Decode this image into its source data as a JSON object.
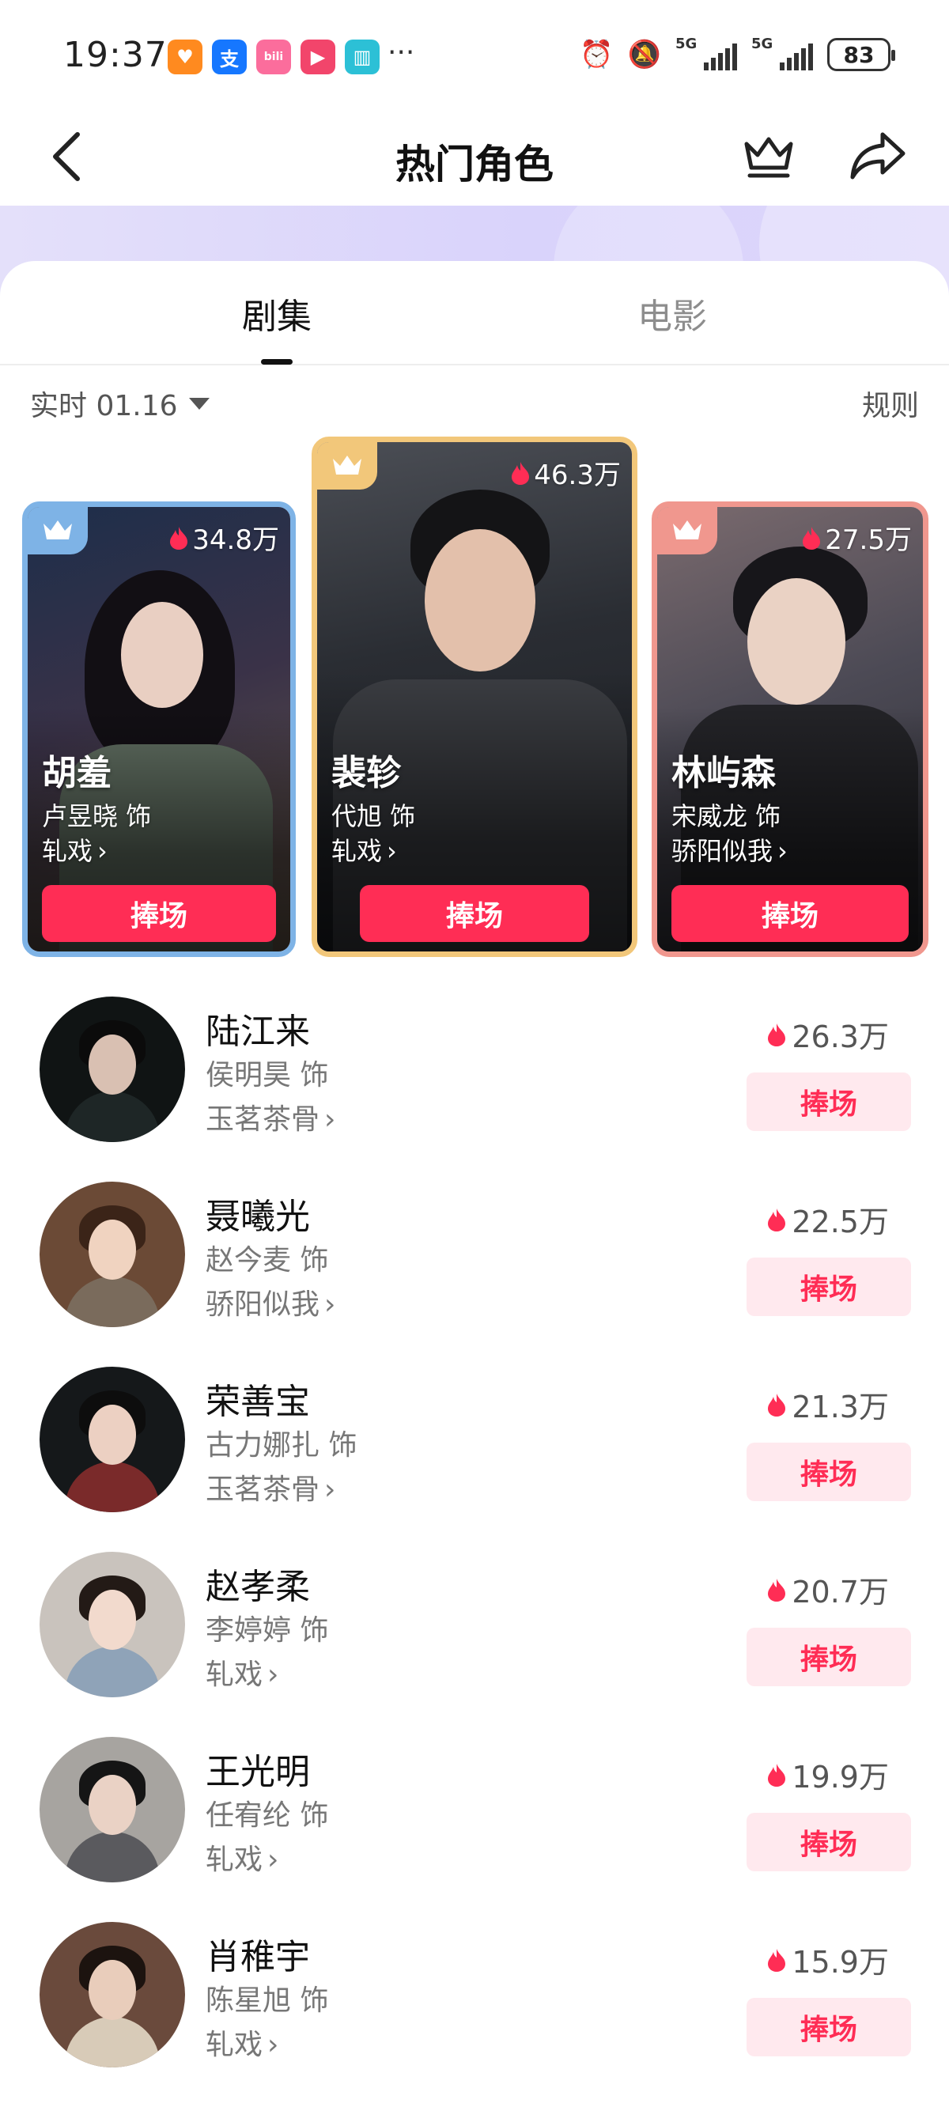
{
  "status_bar": {
    "time": "19:37",
    "more": "···",
    "network_1": "5G",
    "network_2": "5G",
    "battery": "83"
  },
  "header": {
    "title": "热门角色"
  },
  "tabs": [
    {
      "label": "剧集",
      "active": true
    },
    {
      "label": "电影",
      "active": false
    }
  ],
  "filter": {
    "label": "实时 01.16",
    "rules": "规则"
  },
  "colors": {
    "accent": "#ff2d55",
    "accent_light": "#ffe9ee",
    "rank1_border": "#f2c77a",
    "rank2_border": "#7eb3e6",
    "rank3_border": "#f0978e"
  },
  "top3": [
    {
      "rank": 2,
      "name": "胡羞",
      "actor": "卢昱晓 饰",
      "show": "轧戏",
      "heat": "34.8万",
      "button": "捧场"
    },
    {
      "rank": 1,
      "name": "裴轸",
      "actor": "代旭 饰",
      "show": "轧戏",
      "heat": "46.3万",
      "button": "捧场"
    },
    {
      "rank": 3,
      "name": "林屿森",
      "actor": "宋威龙 饰",
      "show": "骄阳似我",
      "heat": "27.5万",
      "button": "捧场"
    }
  ],
  "list": [
    {
      "name": "陆江来",
      "actor": "侯明昊 饰",
      "show": "玉茗茶骨",
      "heat": "26.3万",
      "button": "捧场"
    },
    {
      "name": "聂曦光",
      "actor": "赵今麦 饰",
      "show": "骄阳似我",
      "heat": "22.5万",
      "button": "捧场"
    },
    {
      "name": "荣善宝",
      "actor": "古力娜扎 饰",
      "show": "玉茗茶骨",
      "heat": "21.3万",
      "button": "捧场"
    },
    {
      "name": "赵孝柔",
      "actor": "李婷婷 饰",
      "show": "轧戏",
      "heat": "20.7万",
      "button": "捧场"
    },
    {
      "name": "王光明",
      "actor": "任宥纶 饰",
      "show": "轧戏",
      "heat": "19.9万",
      "button": "捧场"
    },
    {
      "name": "肖稚宇",
      "actor": "陈星旭 饰",
      "show": "轧戏",
      "heat": "15.9万",
      "button": "捧场"
    }
  ]
}
